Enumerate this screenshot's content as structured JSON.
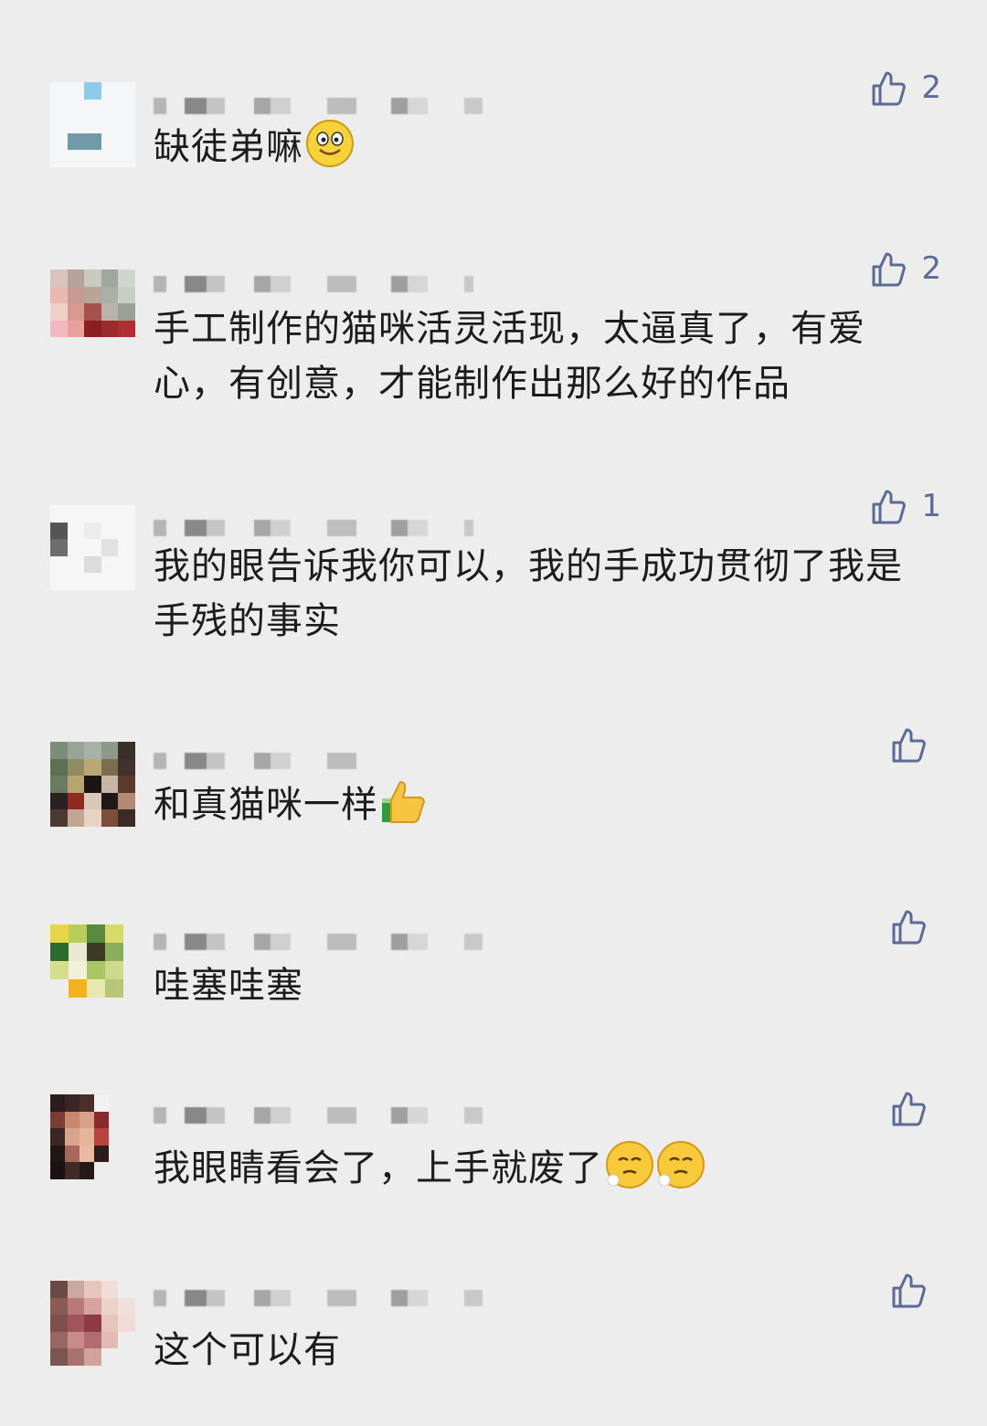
{
  "comments": [
    {
      "text": "缺徒弟嘛",
      "likes": "2",
      "emoji": [
        "smile"
      ]
    },
    {
      "text": "手工制作的猫咪活灵活现，太逼真了，有爱心，有创意，才能制作出那么好的作品",
      "likes": "2",
      "emoji": []
    },
    {
      "text": "我的眼告诉我你可以，我的手成功贯彻了我是手残的事实",
      "likes": "1",
      "emoji": []
    },
    {
      "text": "和真猫咪一样",
      "likes": "",
      "emoji": [
        "thumbs-up"
      ]
    },
    {
      "text": "哇塞哇塞",
      "likes": "",
      "emoji": []
    },
    {
      "text": "我眼睛看会了，上手就废了",
      "likes": "",
      "emoji": [
        "sigh",
        "sigh"
      ]
    },
    {
      "text": "这个可以有",
      "likes": "",
      "emoji": []
    }
  ],
  "colors": {
    "background": "#ededed",
    "text": "#1c1c1c",
    "like": "#5b6b93"
  }
}
